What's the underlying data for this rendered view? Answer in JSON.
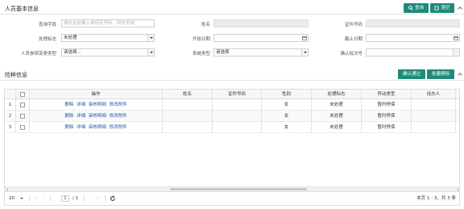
{
  "person_section": {
    "title": "人员基本信息",
    "query_label": "查询",
    "clear_label": "清空"
  },
  "form": {
    "query_field": {
      "label": "查询字段",
      "placeholder": "请在此处输入身份证号码，回车查询"
    },
    "name": {
      "label": "姓名",
      "value": ""
    },
    "id_number": {
      "label": "证件号码",
      "value": ""
    },
    "process_flag": {
      "label": "处理标志",
      "value": "未处理"
    },
    "start_date": {
      "label": "开始日期",
      "value": ""
    },
    "end_date": {
      "label": "截止日期",
      "value": ""
    },
    "change_type": {
      "label": "人员参保变更类型",
      "value": "请选择..."
    },
    "system_type": {
      "label": "系统类型",
      "value": "请选择"
    },
    "confirm_batch": {
      "label": "确认批次号",
      "value": "",
      "dots": "..."
    }
  },
  "insurance_section": {
    "title": "险种信息",
    "confirm_label": "确认通过",
    "batch_delete_label": "批量删除"
  },
  "grid": {
    "columns": [
      "操作",
      "姓名",
      "证件号码",
      "性别",
      "处理标志",
      "异动类型",
      "经办人"
    ],
    "rows": [
      {
        "num": "1",
        "ops": [
          "删除",
          "详细",
          "审核明细",
          "修改附件"
        ],
        "name": "",
        "id": "",
        "gender": "女",
        "flag": "未处理",
        "change": "暂时停保",
        "handler": ""
      },
      {
        "num": "2",
        "ops": [
          "删除",
          "详细",
          "审核明细",
          "修改附件"
        ],
        "name": "",
        "id": "",
        "gender": "女",
        "flag": "未处理",
        "change": "暂时停保",
        "handler": ""
      },
      {
        "num": "3",
        "ops": [
          "删除",
          "详细",
          "审核明细",
          "修改附件"
        ],
        "name": "",
        "id": "",
        "gender": "女",
        "flag": "未处理",
        "change": "暂时停保",
        "handler": ""
      }
    ]
  },
  "pager": {
    "page_size": "20",
    "first": "«",
    "prev": "‹",
    "page": "1",
    "total_pages": "/ 1",
    "next": "›",
    "last": "»",
    "summary": "本页 1 - 3，共 3 条"
  },
  "colors": {
    "accent": "#1f8a7a",
    "link": "#2255aa"
  },
  "icons": [
    "search-icon",
    "clear-icon",
    "collapse-icon",
    "calendar-icon",
    "refresh-icon"
  ]
}
